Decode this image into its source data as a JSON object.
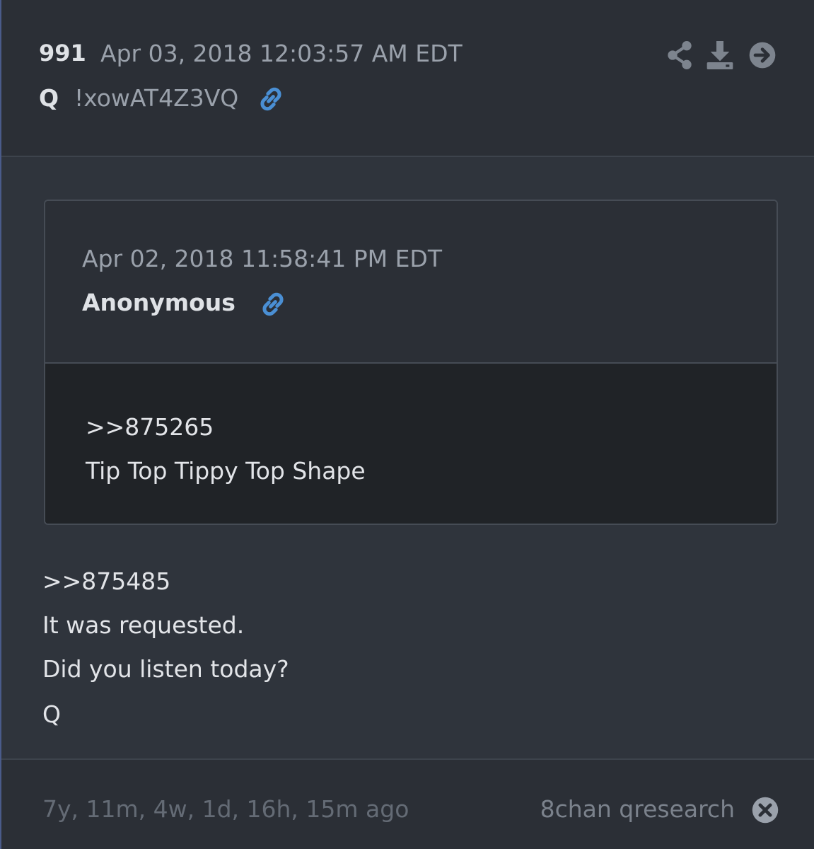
{
  "post": {
    "number": "991",
    "date": "Apr 03, 2018 12:03:57 AM EDT",
    "author": "Q",
    "tripcode": "!xowAT4Z3VQ",
    "message_lines": [
      ">>875485",
      "It was requested.",
      "Did you listen today?",
      "Q"
    ]
  },
  "quoted": {
    "date": "Apr 02, 2018 11:58:41 PM EDT",
    "author": "Anonymous",
    "lines": [
      ">>875265",
      "Tip Top Tippy Top Shape"
    ]
  },
  "footer": {
    "relative_time": "7y, 11m, 4w, 1d, 16h, 15m ago",
    "source": "8chan qresearch"
  },
  "icons": {
    "share": "share-icon",
    "download": "download-icon",
    "navigate": "arrow-right-circle-icon",
    "link": "link-icon",
    "close": "close-circle-icon"
  },
  "colors": {
    "link_blue": "#4a8fd4",
    "icon_gray": "#7d848e"
  }
}
